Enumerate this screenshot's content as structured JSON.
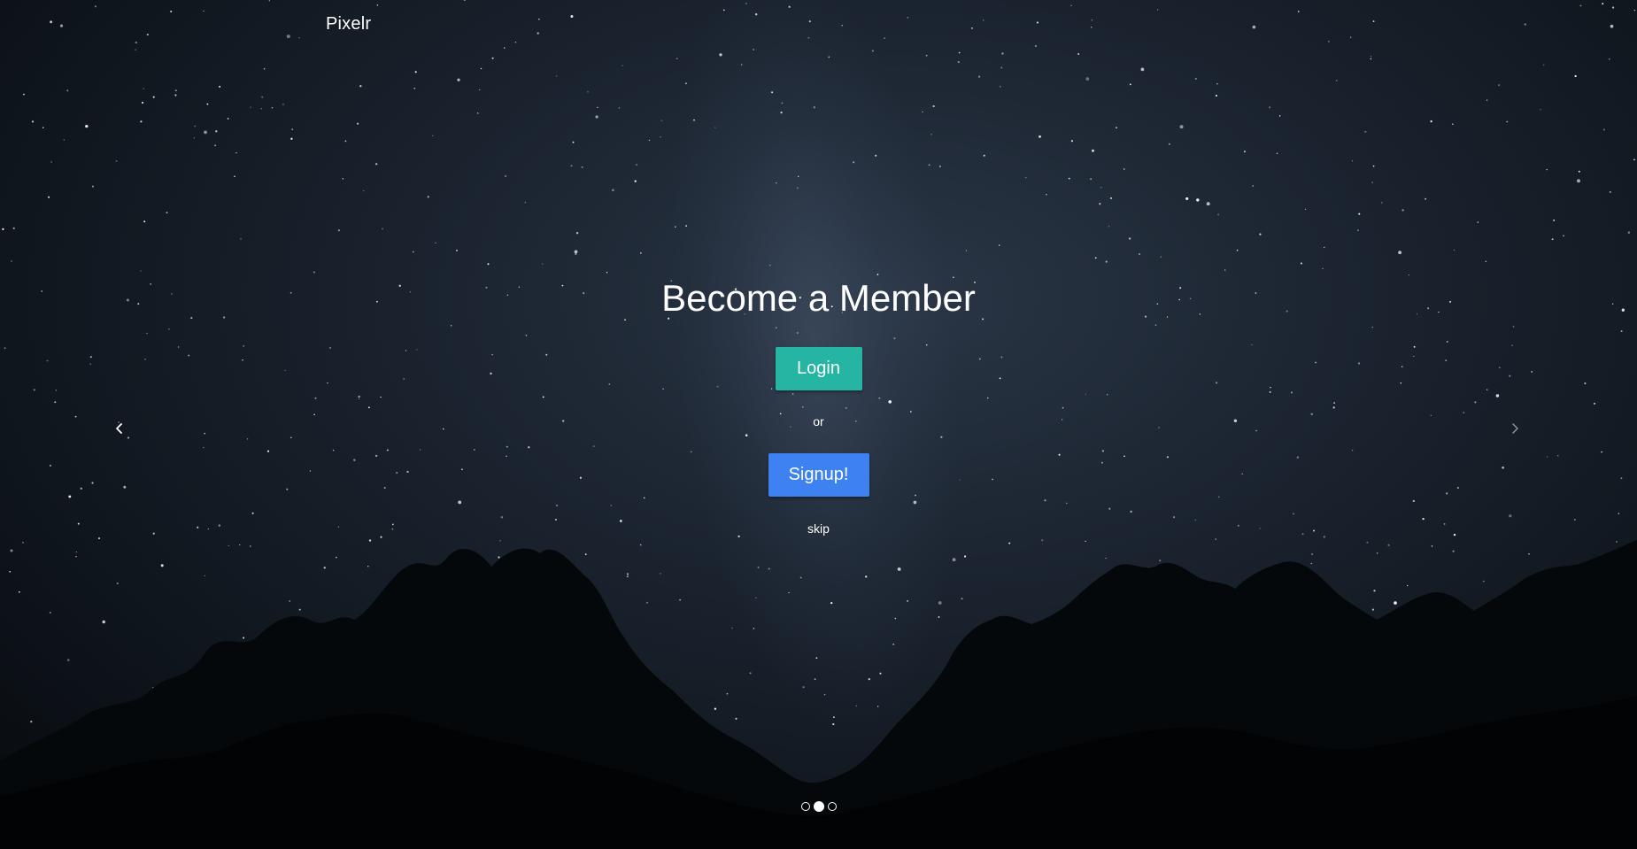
{
  "brand": "Pixelr",
  "hero": {
    "title": "Become a Member",
    "login_label": "Login",
    "or_label": "or",
    "signup_label": "Signup!",
    "skip_label": "skip"
  },
  "carousel": {
    "prev_icon": "chevron-left-icon",
    "next_icon": "chevron-right-icon",
    "slide_count": 3,
    "active_slide": 2
  },
  "colors": {
    "login": "#26b5a2",
    "signup": "#3d82f0",
    "text": "#ffffff"
  }
}
